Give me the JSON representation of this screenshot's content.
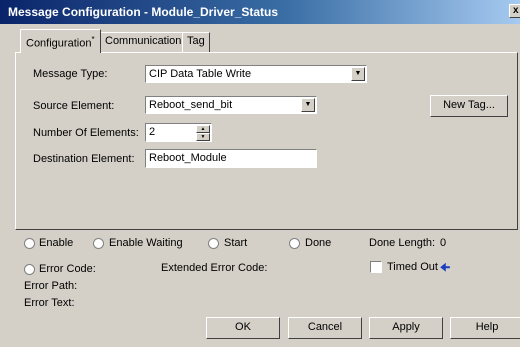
{
  "window": {
    "title": "Message Configuration - Module_Driver_Status",
    "close_glyph": "x"
  },
  "tabs": [
    {
      "label": "Configuration",
      "marker": "*",
      "active": true
    },
    {
      "label": "Communication",
      "active": false
    },
    {
      "label": "Tag",
      "active": false
    }
  ],
  "config": {
    "message_type_label": "Message Type:",
    "message_type_value": "CIP Data Table Write",
    "source_element_label": "Source Element:",
    "source_element_value": "Reboot_send_bit",
    "num_elements_label": "Number Of Elements:",
    "num_elements_value": "2",
    "destination_label": "Destination Element:",
    "destination_value": "Reboot_Module",
    "new_tag_label": "New Tag..."
  },
  "status": {
    "enable": "Enable",
    "enable_waiting": "Enable Waiting",
    "start": "Start",
    "done": "Done",
    "done_length_label": "Done Length:",
    "done_length_value": "0",
    "error_code": "Error Code:",
    "extended_error_code": "Extended Error Code:",
    "timed_out": "Timed Out",
    "error_path": "Error Path:",
    "error_text": "Error Text:"
  },
  "buttons": {
    "ok": "OK",
    "cancel": "Cancel",
    "apply": "Apply",
    "help": "Help"
  },
  "icons": {
    "arrow": "arrow-left-icon"
  },
  "colors": {
    "titlebar_start": "#0a246a",
    "titlebar_end": "#a6caf0",
    "face": "#d4d0c8",
    "arrow": "#1d3fbf"
  }
}
